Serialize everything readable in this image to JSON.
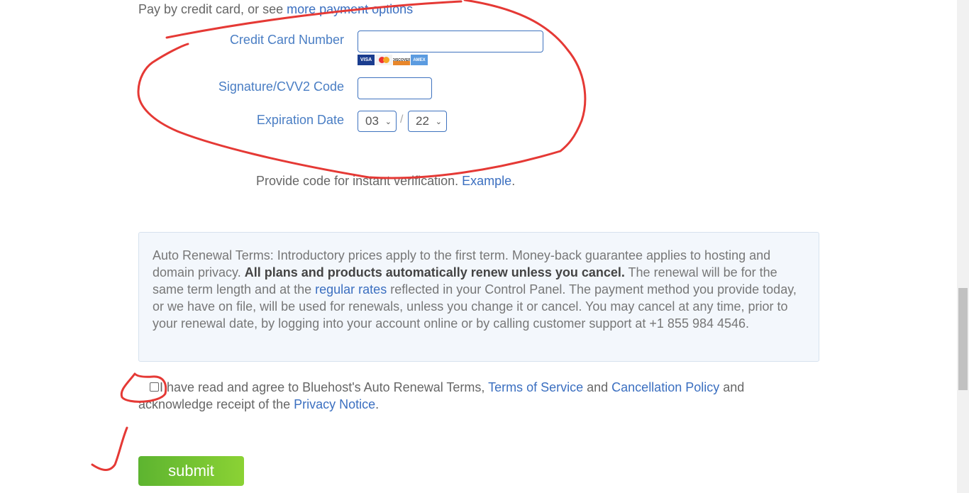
{
  "intro": {
    "text": "Pay by credit card, or see ",
    "link": "more payment options"
  },
  "form": {
    "card_number_label": "Credit Card Number",
    "card_number_value": "",
    "cards": [
      "VISA",
      "MC",
      "DISCOVER",
      "AMEX"
    ],
    "cvv_label": "Signature/CVV2 Code",
    "cvv_value": "",
    "expiration_label": "Expiration Date",
    "exp_month": "03",
    "exp_separator": "/",
    "exp_year": "22",
    "verify_text": "Provide code for instant verification. ",
    "verify_link": "Example",
    "verify_end": "."
  },
  "terms": {
    "t1": "Auto Renewal Terms: Introductory prices apply to the first term. Money-back guarantee applies to hosting and domain privacy. ",
    "bold": "All plans and products automatically renew unless you cancel.",
    "t2": " The renewal will be for the same term length and at the ",
    "link": "regular rates",
    "t3": " reflected in your Control Panel. The payment method you provide today, or we have on file, will be used for renewals, unless you change it or cancel. You may cancel at any time, prior to your renewal date, by logging into your account online or by calling customer support at +1 855 984 4546."
  },
  "agree": {
    "t1": " I have read and agree to Bluehost's Auto Renewal Terms, ",
    "tos": "Terms of Service",
    "t2": " and ",
    "cancel": "Cancellation Policy",
    "t3": " and acknowledge receipt of the ",
    "privacy": "Privacy Notice",
    "t4": ".",
    "checked": false
  },
  "submit_label": "submit",
  "colors": {
    "label": "#4a7ec4",
    "submit": "#6cc231",
    "annotation": "#e53935"
  }
}
